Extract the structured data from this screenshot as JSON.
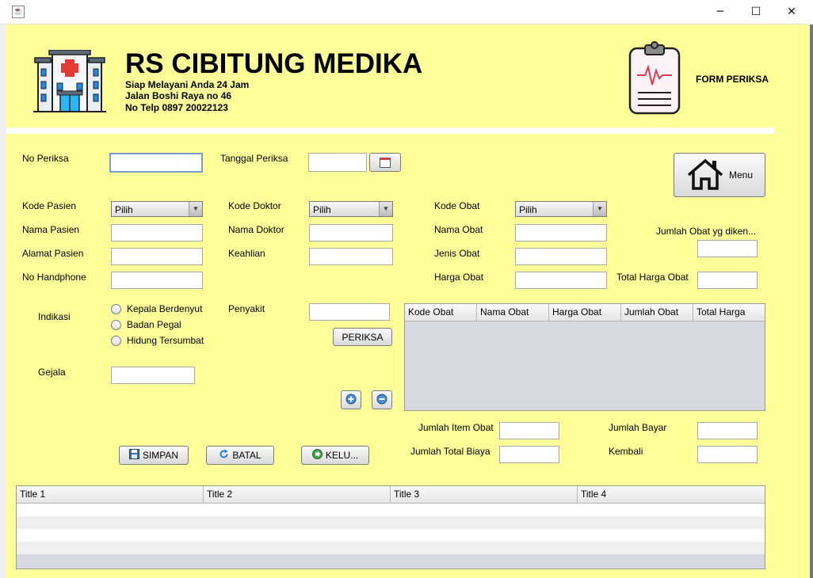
{
  "window": {
    "app_icon": "java-icon",
    "controls": {
      "minimize": "─",
      "maximize": "☐",
      "close": "✕"
    }
  },
  "header": {
    "title": "RS CIBITUNG MEDIKA",
    "tagline": "Siap Melayani Anda 24 Jam",
    "address": "Jalan Boshi Raya no 46",
    "phone": "No Telp 0897 20022123",
    "form_label": "FORM PERIKSA",
    "hospital_icon": "hospital-building-icon",
    "clipboard_icon": "medical-clipboard-icon"
  },
  "form": {
    "no_periksa_label": "No Periksa",
    "tanggal_periksa_label": "Tanggal Periksa",
    "kode_pasien_label": "Kode Pasien",
    "nama_pasien_label": "Nama Pasien",
    "alamat_pasien_label": "Alamat Pasien",
    "no_handphone_label": "No Handphone",
    "kode_doktor_label": "Kode Doktor",
    "nama_doktor_label": "Nama Doktor",
    "keahlian_label": "Keahlian",
    "kode_obat_label": "Kode Obat",
    "nama_obat_label": "Nama Obat",
    "jenis_obat_label": "Jenis Obat",
    "harga_obat_label": "Harga Obat",
    "jumlah_obat_label": "Jumlah Obat yg diken...",
    "total_harga_obat_label": "Total Harga Obat",
    "combo_default": "Pilih",
    "indikasi_label": "Indikasi",
    "indikasi_options": [
      "Kepala Berdenyut",
      "Badan Pegal",
      "Hidung Tersumbat"
    ],
    "penyakit_label": "Penyakit",
    "gejala_label": "Gejala",
    "jumlah_item_obat_label": "Jumlah Item Obat",
    "jumlah_total_biaya_label": "Jumlah Total Biaya",
    "jumlah_bayar_label": "Jumlah Bayar",
    "kembali_label": "Kembali"
  },
  "buttons": {
    "menu": "Menu",
    "periksa": "PERIKSA",
    "simpan": "SIMPAN",
    "batal": "BATAL",
    "keluar": "KELU..."
  },
  "obat_table": {
    "headers": [
      "Kode Obat",
      "Nama Obat",
      "Harga Obat",
      "Jumlah Obat",
      "Total Harga"
    ],
    "rows": []
  },
  "bottom_table": {
    "headers": [
      "Title 1",
      "Title 2",
      "Title 3",
      "Title 4"
    ],
    "rows": [
      [
        "",
        "",
        "",
        ""
      ],
      [
        "",
        "",
        "",
        ""
      ],
      [
        "",
        "",
        "",
        ""
      ],
      [
        "",
        "",
        "",
        ""
      ]
    ]
  }
}
